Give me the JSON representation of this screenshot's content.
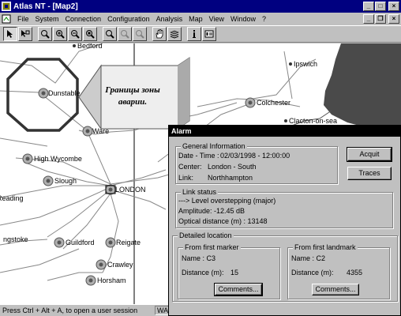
{
  "window": {
    "title": "Atlas NT - [Map2]"
  },
  "menu": {
    "items": [
      "File",
      "System",
      "Connection",
      "Configuration",
      "Analysis",
      "Map",
      "View",
      "Window",
      "?"
    ]
  },
  "map": {
    "places": {
      "bedford": "Bedford",
      "dunstable": "Dunstable",
      "ware": "Ware",
      "ipswich": "Ipswich",
      "colchester": "Colchester",
      "clacton": "Clacton-on-sea",
      "high_wycombe": "High Wycombe",
      "slough": "Slough",
      "london": "LONDON",
      "reading": "Reading",
      "basingstoke": "ngstoke",
      "guildford": "Guildford",
      "reigate": "Reigate",
      "crawley": "Crawley",
      "horsham": "Horsham"
    },
    "callout_line1": "Границы зоны",
    "callout_line2": "аварии."
  },
  "alarm": {
    "title": "Alarm",
    "general": {
      "label": "General Information",
      "datetime_label": "Date - Time :",
      "datetime_value": "02/03/1998 - 12:00:00",
      "center_label": "Center:",
      "center_value": "London - South",
      "link_label": "Link:",
      "link_value": "Northhampton"
    },
    "acquit_label": "Acquit",
    "traces_label": "Traces",
    "link_status": {
      "label": "Link status",
      "message": "---> Level overstepping (major)",
      "amplitude": "Amplitude: -12.45 dB",
      "optical": "Optical distance (m) : 13148"
    },
    "detailed": {
      "label": "Detailed location",
      "marker": {
        "label": "From first marker",
        "name": "Name : C3",
        "distance_label": "Distance (m):",
        "distance_value": "15",
        "comments": "Comments..."
      },
      "landmark": {
        "label": "From first landmark",
        "name": "Name : C2",
        "distance_label": "Distance (m):",
        "distance_value": "4355",
        "comments": "Comments..."
      }
    }
  },
  "status": {
    "message": "Press Ctrl + Alt + A, to open a user session",
    "panel": "WA"
  }
}
